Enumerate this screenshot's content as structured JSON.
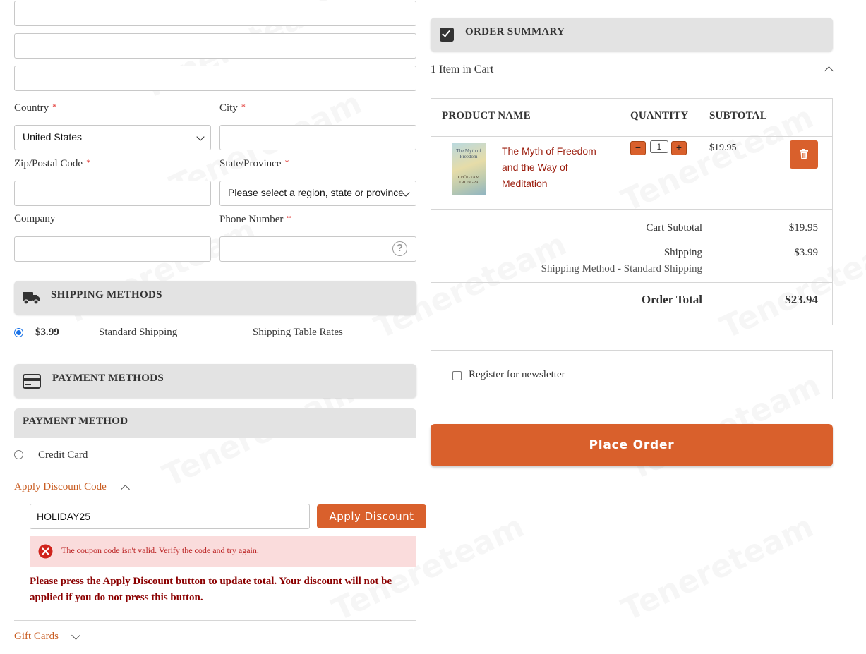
{
  "address": {
    "country_label": "Country",
    "country_value": "United States",
    "city_label": "City",
    "zip_label": "Zip/Postal Code",
    "state_label": "State/Province",
    "state_placeholder": "Please select a region, state or province.",
    "company_label": "Company",
    "phone_label": "Phone Number",
    "required_mark": "*"
  },
  "shipping": {
    "title": "SHIPPING METHODS",
    "price": "$3.99",
    "method": "Standard Shipping",
    "carrier": "Shipping Table Rates"
  },
  "payment": {
    "title": "PAYMENT METHODS",
    "subtitle": "PAYMENT METHOD",
    "option": "Credit Card"
  },
  "discount": {
    "toggle_label": "Apply Discount Code",
    "code_value": "HOLIDAY25",
    "apply_label": "Apply Discount",
    "error": "The coupon code isn't valid. Verify the code and try again.",
    "notice": "Please press the Apply Discount button to update total. Your discount will not be applied if you do not press this button."
  },
  "gift": {
    "label": "Gift Cards"
  },
  "summary": {
    "title": "ORDER SUMMARY",
    "items_in_cart": "1 Item in Cart",
    "columns": [
      "PRODUCT NAME",
      "QUANTITY",
      "SUBTOTAL"
    ],
    "item": {
      "name": "The Myth of Freedom and the Way of Meditation",
      "qty": "1",
      "subtotal": "$19.95",
      "minus": "−",
      "plus": "+"
    },
    "cart_subtotal_label": "Cart Subtotal",
    "cart_subtotal": "$19.95",
    "shipping_label": "Shipping",
    "shipping_value": "$3.99",
    "shipping_method": "Shipping Method - Standard Shipping",
    "total_label": "Order Total",
    "total_value": "$23.94"
  },
  "newsletter": {
    "label": "Register for newsletter"
  },
  "place_order": {
    "label": "Place Order"
  },
  "book_cover": {
    "title": "The Myth of Freedom",
    "author": "CHÖGYAM TRUNGPA"
  },
  "watermark_text": "Tenereteam",
  "colors": {
    "accent": "#d9602c",
    "link": "#c95d22",
    "error_bg": "#fadcdc",
    "error_icon": "#d0241c",
    "notice": "#8b0000",
    "product_link": "#9b1c0c"
  }
}
